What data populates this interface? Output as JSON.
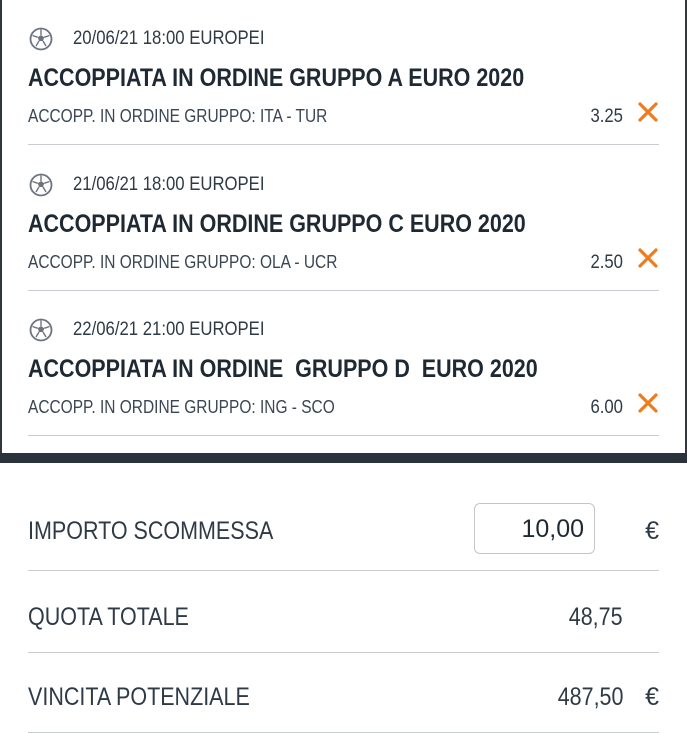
{
  "bets": [
    {
      "meta": "20/06/21 18:00 EUROPEI",
      "title": "ACCOPPIATA IN ORDINE GRUPPO A EURO 2020",
      "selection": "ACCOPP. IN ORDINE GRUPPO: ITA - TUR",
      "odds": "3.25"
    },
    {
      "meta": "21/06/21 18:00 EUROPEI",
      "title": "ACCOPPIATA IN ORDINE GRUPPO C EURO 2020",
      "selection": "ACCOPP. IN ORDINE GRUPPO: OLA - UCR",
      "odds": "2.50"
    },
    {
      "meta": "22/06/21 21:00 EUROPEI",
      "title": "ACCOPPIATA IN ORDINE  GRUPPO D  EURO 2020",
      "selection": "ACCOPP. IN ORDINE GRUPPO: ING - SCO",
      "odds": "6.00"
    }
  ],
  "summary": {
    "stake_label": "IMPORTO SCOMMESSA",
    "stake_value": "10,00",
    "currency": "€",
    "total_odds_label": "QUOTA TOTALE",
    "total_odds_value": "48,75",
    "potential_win_label": "VINCITA POTENZIALE",
    "potential_win_value": "487,50",
    "potential_win_currency": "€"
  },
  "icons": {
    "sport": "soccer-ball-icon",
    "remove": "close-icon"
  },
  "colors": {
    "accent": "#f07b1d",
    "text": "#2f3a47",
    "bar": "#2a323c",
    "divider": "#c9ccd1"
  }
}
